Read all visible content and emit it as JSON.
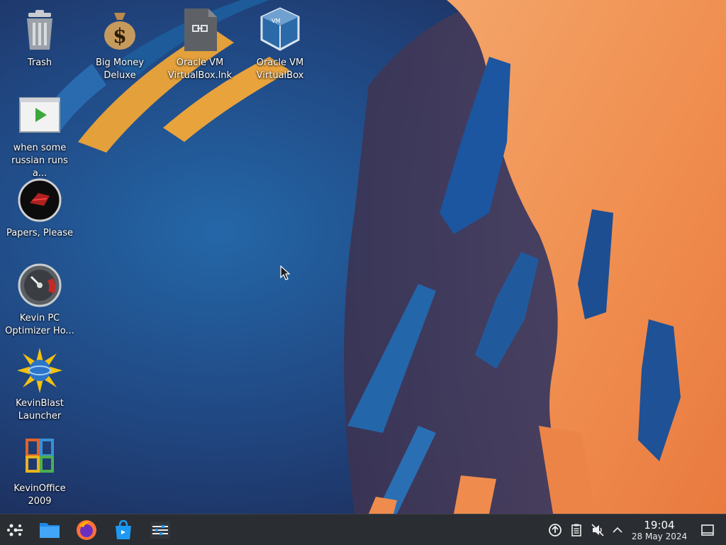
{
  "desktop": {
    "icons": [
      {
        "label": "Trash",
        "icon": "trash-icon"
      },
      {
        "label": "Big Money Deluxe",
        "icon": "money-bag-icon"
      },
      {
        "label": "Oracle VM VirtualBox.lnk",
        "icon": "link-file-icon"
      },
      {
        "label": "Oracle VM VirtualBox",
        "icon": "virtualbox-icon"
      },
      {
        "label": "when some russian runs a...",
        "icon": "video-file-icon"
      },
      {
        "label": "Papers, Please",
        "icon": "papers-please-icon"
      },
      {
        "label": "Kevin PC Optimizer Ho...",
        "icon": "gauge-icon"
      },
      {
        "label": "KevinBlast Launcher",
        "icon": "globe-burst-icon"
      },
      {
        "label": "KevinOffice 2009",
        "icon": "office-icon"
      }
    ]
  },
  "taskbar": {
    "launchers": [
      "application-launcher-icon",
      "file-manager-icon",
      "firefox-icon",
      "discover-store-icon",
      "system-settings-icon"
    ],
    "tray": [
      "update-notifier-icon",
      "clipboard-icon",
      "volume-muted-icon",
      "show-hidden-chevron-icon",
      "show-desktop-icon"
    ],
    "clock": {
      "time": "19:04",
      "date": "28 May 2024"
    }
  },
  "colors": {
    "panel": "#2a2e32",
    "wallpaper_orange": "#f08c4a",
    "wallpaper_blue": "#1c5a9c"
  }
}
